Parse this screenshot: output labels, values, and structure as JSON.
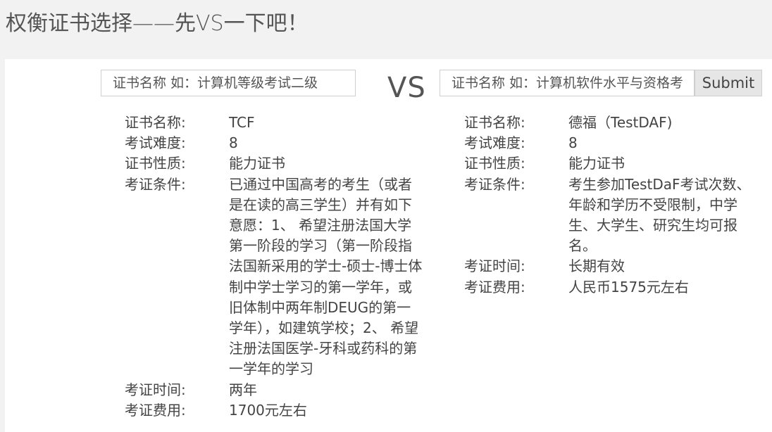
{
  "page": {
    "title": "权衡证书选择——先VS一下吧！"
  },
  "search": {
    "left_placeholder": "证书名称 如：计算机等级考试二级",
    "vs_label": "VS",
    "right_placeholder": "证书名称 如：计算机软件水平与资格考试",
    "submit_label": "Submit"
  },
  "labels": {
    "name": "证书名称:",
    "difficulty": "考试难度:",
    "nature": "证书性质:",
    "conditions": "考证条件:",
    "time": "考证时间:",
    "fee": "考证费用:"
  },
  "left_cert": {
    "name": "TCF",
    "difficulty": "8",
    "nature": "能力证书",
    "conditions": "已通过中国高考的考生（或者是在读的高三学生）并有如下意愿：1、 希望注册法国大学第一阶段的学习（第一阶段指法国新采用的学士-硕士-博士体制中学士学习的第一学年，或旧体制中两年制DEUG的第一学年），如建筑学校；2、 希望注册法国医学-牙科或药科的第一学年的学习",
    "time": "两年",
    "fee": "1700元左右"
  },
  "right_cert": {
    "name": "德福（TestDAF)",
    "difficulty": "8",
    "nature": "能力证书",
    "conditions": "考生参加TestDaF考试次数、年龄和学历不受限制，中学生、大学生、研究生均可报名。",
    "time": "长期有效",
    "fee": "人民币1575元左右"
  }
}
